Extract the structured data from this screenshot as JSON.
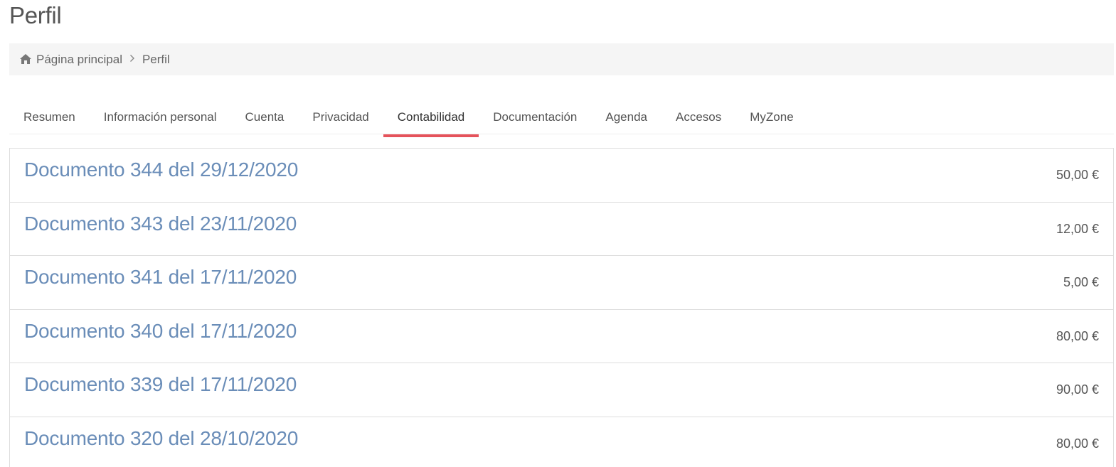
{
  "page": {
    "title": "Perfil"
  },
  "breadcrumb": {
    "home_icon": "home-icon",
    "home_label": "Página principal",
    "separator": ">",
    "current": "Perfil"
  },
  "tabs": [
    {
      "label": "Resumen",
      "active": false
    },
    {
      "label": "Información personal",
      "active": false
    },
    {
      "label": "Cuenta",
      "active": false
    },
    {
      "label": "Privacidad",
      "active": false
    },
    {
      "label": "Contabilidad",
      "active": true
    },
    {
      "label": "Documentación",
      "active": false
    },
    {
      "label": "Agenda",
      "active": false
    },
    {
      "label": "Accesos",
      "active": false
    },
    {
      "label": "MyZone",
      "active": false
    }
  ],
  "documents": [
    {
      "title": "Documento 344 del 29/12/2020",
      "amount": "50,00 €"
    },
    {
      "title": "Documento 343 del 23/11/2020",
      "amount": "12,00 €"
    },
    {
      "title": "Documento 341 del 17/11/2020",
      "amount": "5,00 €"
    },
    {
      "title": "Documento 340 del 17/11/2020",
      "amount": "80,00 €"
    },
    {
      "title": "Documento 339 del 17/11/2020",
      "amount": "90,00 €"
    },
    {
      "title": "Documento 320 del 28/10/2020",
      "amount": "80,00 €"
    }
  ],
  "colors": {
    "accent": "#e5535b",
    "link": "#6a8db8",
    "breadcrumb_bg": "#f5f5f5",
    "border": "#dddddd"
  }
}
